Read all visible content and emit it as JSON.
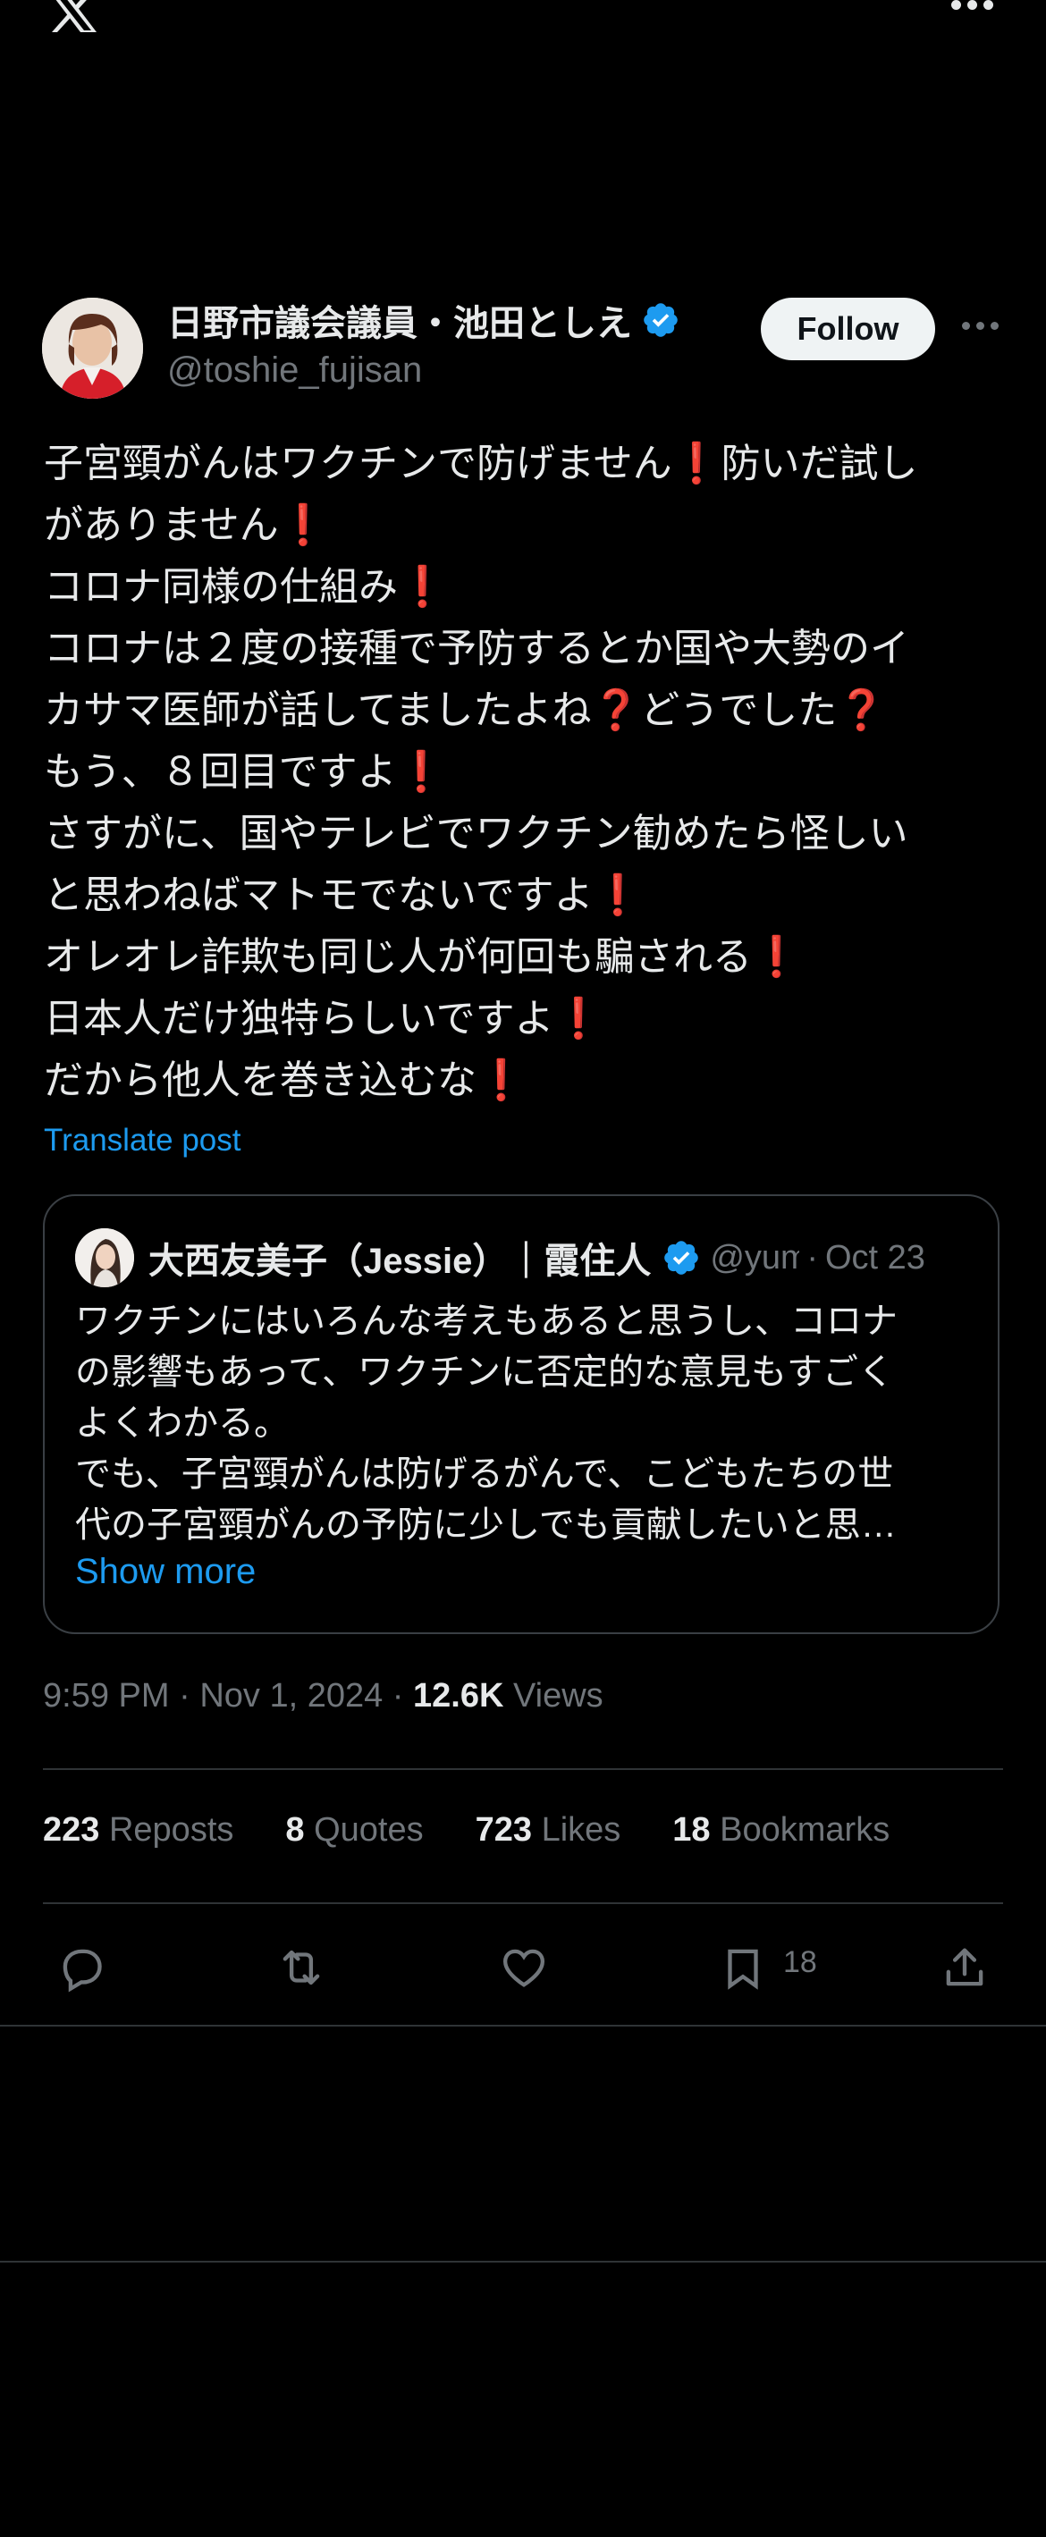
{
  "header": {
    "logo_icon": "x-logo-icon",
    "more_icon": "more-horizontal-icon"
  },
  "author": {
    "display_name": "日野市議会議員・池田としえ",
    "handle": "@toshie_fujisan",
    "verified_icon": "verified-badge-icon"
  },
  "follow_label": "Follow",
  "tweet": {
    "lines": [
      {
        "text": "子宮頸がんはワクチンで防げません",
        "mark": "❗",
        "tail": "防いだ試し"
      },
      {
        "text": "がありません",
        "mark": "❗",
        "tail": ""
      },
      {
        "text": "コロナ同様の仕組み",
        "mark": "❗",
        "tail": ""
      },
      {
        "text": "コロナは２度の接種で予防するとか国や大勢のイ",
        "mark": "",
        "tail": ""
      },
      {
        "text": "カサマ医師が話してましたよね",
        "mark": "❓",
        "tail": "どうでした",
        "mark2": "❓"
      },
      {
        "text": "もう、８回目ですよ",
        "mark": "❗",
        "tail": ""
      },
      {
        "text": "さすがに、国やテレビでワクチン勧めたら怪しい",
        "mark": "",
        "tail": ""
      },
      {
        "text": "と思わねばマトモでないですよ",
        "mark": "❗",
        "tail": ""
      },
      {
        "text": "オレオレ詐欺も同じ人が何回も騙される",
        "mark": "❗",
        "tail": ""
      },
      {
        "text": "日本人だけ独特らしいですよ",
        "mark": "❗",
        "tail": ""
      },
      {
        "text": "だから他人を巻き込むな",
        "mark": "❗",
        "tail": ""
      }
    ],
    "translate_label": "Translate post"
  },
  "quote": {
    "display_name": "大西友美子（Jessie）｜霞住人",
    "handle": "@yum",
    "separator": "·",
    "date": "Oct 23",
    "lines": [
      "ワクチンにはいろんな考えもあると思うし、コロナ",
      "の影響もあって、ワクチンに否定的な意見もすごく",
      "よくわかる。",
      "でも、子宮頸がんは防げるがんで、こどもたちの世",
      "代の子宮頸がんの予防に少しでも貢献したいと思…"
    ],
    "show_more": "Show more"
  },
  "meta": {
    "time": "9:59 PM",
    "sep1": "·",
    "date": "Nov 1, 2024",
    "sep2": "·",
    "views_count": "12.6K",
    "views_label": "Views"
  },
  "stats": {
    "reposts_count": "223",
    "reposts_label": "Reposts",
    "quotes_count": "8",
    "quotes_label": "Quotes",
    "likes_count": "723",
    "likes_label": "Likes",
    "bookmarks_count": "18",
    "bookmarks_label": "Bookmarks"
  },
  "actions": {
    "reply_icon": "reply-icon",
    "repost_icon": "repost-icon",
    "like_icon": "heart-icon",
    "bookmark_icon": "bookmark-icon",
    "bookmark_count": "18",
    "share_icon": "share-icon"
  },
  "colors": {
    "accent": "#1d9bf0",
    "background": "#000000",
    "text": "#e7e9ea",
    "muted": "#71767b",
    "mark": "#e0245e"
  }
}
